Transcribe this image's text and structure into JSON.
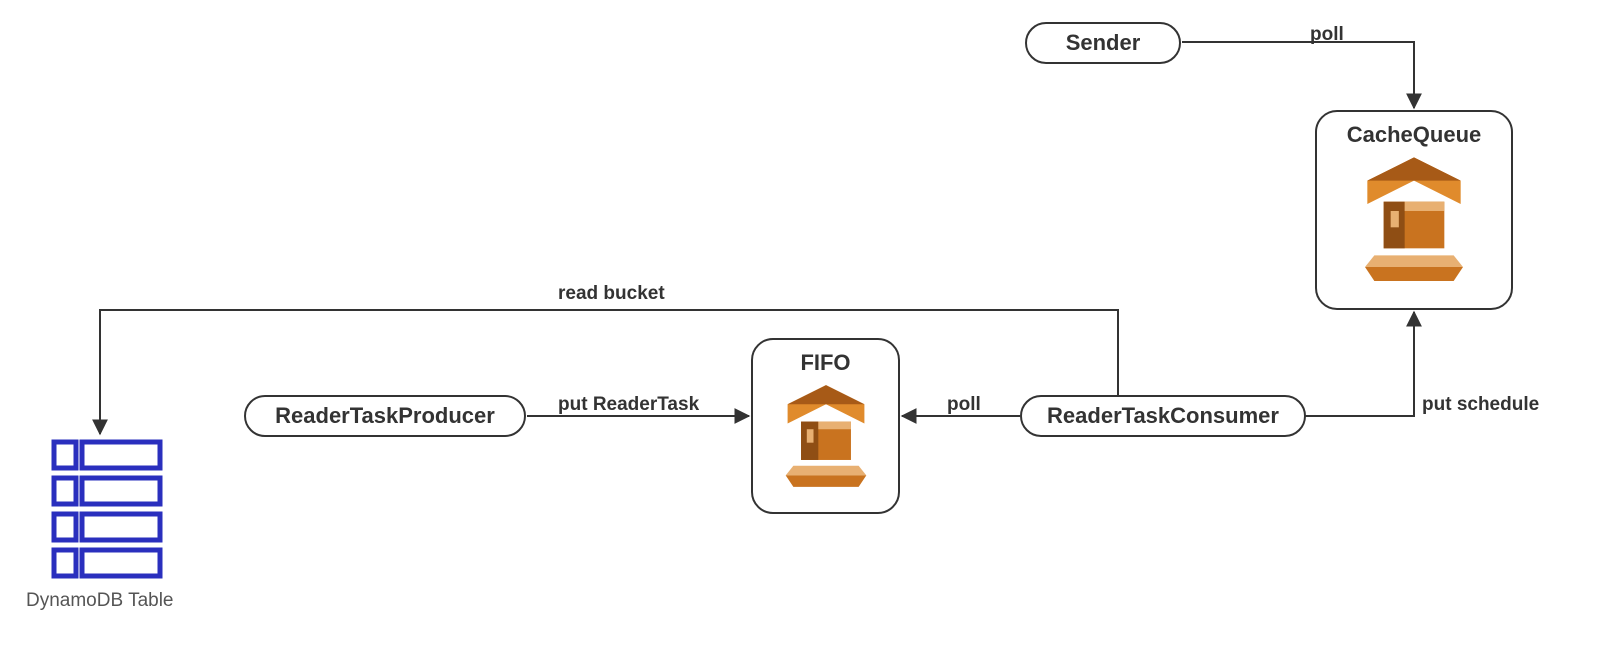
{
  "nodes": {
    "sender": {
      "label": "Sender"
    },
    "cacheQueue": {
      "label": "CacheQueue"
    },
    "readerTaskProducer": {
      "label": "ReaderTaskProducer"
    },
    "fifo": {
      "label": "FIFO"
    },
    "readerTaskConsumer": {
      "label": "ReaderTaskConsumer"
    },
    "dynamoTable": {
      "label": "DynamoDB Table"
    }
  },
  "edges": {
    "senderToCache": {
      "label": "poll"
    },
    "consumerToCache": {
      "label": "put schedule"
    },
    "consumerToDynamo": {
      "label": "read bucket"
    },
    "consumerToFifo": {
      "label": "poll"
    },
    "producerToFifo": {
      "label": "put ReaderTask"
    }
  }
}
